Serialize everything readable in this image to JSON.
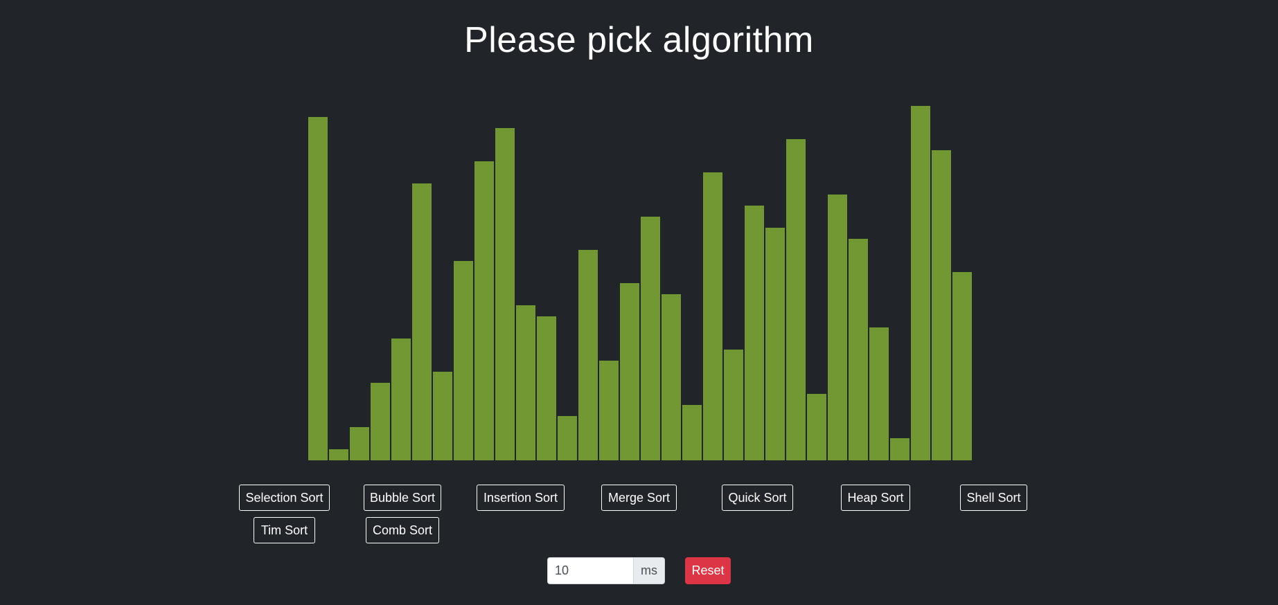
{
  "title": "Please pick algorithm",
  "colors": {
    "background": "#212429",
    "bar": "#729833",
    "reset": "#dc3545"
  },
  "chart_data": {
    "type": "bar",
    "values": [
      31,
      1,
      3,
      7,
      11,
      25,
      8,
      18,
      27,
      30,
      14,
      13,
      4,
      19,
      9,
      16,
      22,
      15,
      5,
      26,
      10,
      23,
      21,
      29,
      6,
      24,
      20,
      12,
      2,
      32,
      28,
      17
    ],
    "bar_color": "#729833"
  },
  "algorithms": {
    "selection": "Selection Sort",
    "bubble": "Bubble Sort",
    "insertion": "Insertion Sort",
    "merge": "Merge Sort",
    "quick": "Quick Sort",
    "heap": "Heap Sort",
    "shell": "Shell Sort",
    "tim": "Tim Sort",
    "comb": "Comb Sort"
  },
  "controls": {
    "delay_value": "10",
    "delay_unit": "ms",
    "reset_label": "Reset"
  }
}
